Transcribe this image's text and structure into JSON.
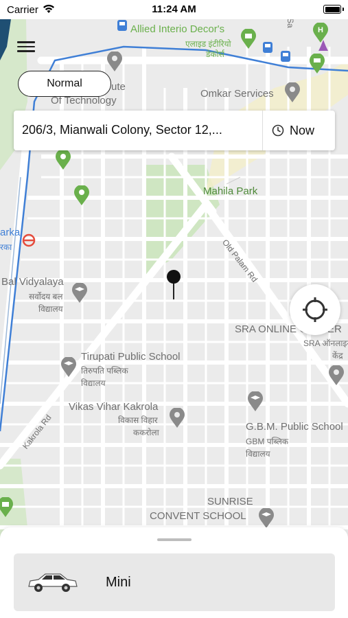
{
  "status_bar": {
    "carrier": "Carrier",
    "time": "11:24 AM"
  },
  "mode_button": {
    "label": "Normal"
  },
  "address": {
    "text": "206/3, Mianwali Colony, Sector 12,...",
    "time_label": "Now"
  },
  "map_labels": {
    "allied": "Allied Interio Decor's",
    "allied_hi_1": "एलाइड इंटीरियो",
    "allied_hi_2": "डेकोर्स",
    "omkar": "Omkar Services",
    "institute_1": "ute",
    "institute_2": "Of Technology",
    "mahila_park": "Mahila Park",
    "old_palam": "Old Palam Rd",
    "dwarka_1": "arka",
    "dwarka_2": "रका",
    "bal_vidyalaya": "Bal Vidyalaya",
    "bal_hi_1": "सर्वोदय बल",
    "bal_hi_2": "विद्यालय",
    "sra": "SRA ONLINE CENTER",
    "sra_hi_1": "SRA ऑनलाइन",
    "sra_hi_2": "केंद्र",
    "tirupati": "Tirupati Public School",
    "tirupati_hi_1": "तिरुपति पब्लिक",
    "tirupati_hi_2": "विद्यालय",
    "vikas_vihar": "Vikas Vihar Kakrola",
    "vikas_hi_1": "विकास विहार",
    "vikas_hi_2": "ककरोला",
    "gbm": "G.B.M. Public School",
    "gbm_hi_1": "GBM पब्लिक",
    "gbm_hi_2": "विद्यालय",
    "kakrola_rd": "Kakrola Rd",
    "sunrise_1": "SUNRISE",
    "sunrise_2": "CONVENT SCHOOL",
    "sa": "Sa"
  },
  "vehicle": {
    "name": "Mini"
  },
  "colors": {
    "map_bg": "#ebebeb",
    "road": "#ffffff",
    "park": "#cfe6c2",
    "metro_line": "#3f7fd6",
    "poi_gray": "#8a8a8a",
    "poi_green": "#6ab04c"
  }
}
